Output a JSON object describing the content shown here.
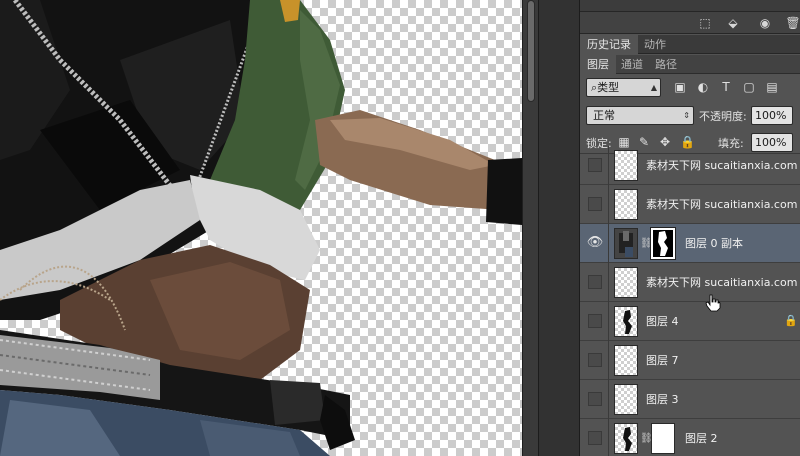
{
  "icon_bar": {
    "icons": [
      "dotted-square-icon",
      "layer-arrow-icon",
      "eye-icon",
      "trash-icon"
    ]
  },
  "history_tabs": [
    {
      "label": "历史记录",
      "active": true
    },
    {
      "label": "动作",
      "active": false
    }
  ],
  "layers_tabs": [
    {
      "label": "图层",
      "active": true
    },
    {
      "label": "通道",
      "active": false
    },
    {
      "label": "路径",
      "active": false
    }
  ],
  "filter": {
    "kind_label": "类型",
    "icons": [
      "image-filter-icon",
      "adjustment-filter-icon",
      "type-filter-icon",
      "shape-filter-icon",
      "smart-object-filter-icon"
    ]
  },
  "blend": {
    "mode": "正常",
    "opacity_label": "不透明度:",
    "opacity_value": "100%"
  },
  "lock": {
    "label": "锁定:",
    "icons": [
      "lock-transparent-icon",
      "lock-image-icon",
      "lock-position-icon",
      "lock-all-icon"
    ],
    "fill_label": "填充:",
    "fill_value": "100%"
  },
  "layers": [
    {
      "name": "素材天下网 sucaitianxia.com",
      "visible": false,
      "selected": false,
      "has_mask": false,
      "locked": false,
      "thumb": "transparent"
    },
    {
      "name": "素材天下网 sucaitianxia.com",
      "visible": false,
      "selected": false,
      "has_mask": false,
      "locked": false,
      "thumb": "transparent"
    },
    {
      "name": "图层 0 副本",
      "visible": true,
      "selected": true,
      "has_mask": true,
      "locked": false,
      "thumb": "person"
    },
    {
      "name": "素材天下网 sucaitianxia.com",
      "visible": false,
      "selected": false,
      "has_mask": false,
      "locked": false,
      "thumb": "transparent"
    },
    {
      "name": "图层 4",
      "visible": false,
      "selected": false,
      "has_mask": false,
      "locked": true,
      "thumb": "silhouette"
    },
    {
      "name": "图层 7",
      "visible": false,
      "selected": false,
      "has_mask": false,
      "locked": false,
      "thumb": "transparent"
    },
    {
      "name": "图层 3",
      "visible": false,
      "selected": false,
      "has_mask": false,
      "locked": false,
      "thumb": "transparent"
    },
    {
      "name": "图层 2",
      "visible": false,
      "selected": false,
      "has_mask": true,
      "locked": false,
      "thumb": "silhouette"
    }
  ],
  "colors": {
    "panel_bg": "#535353",
    "selected_row": "#5a6574",
    "canvas_checker": "#cccccc"
  }
}
